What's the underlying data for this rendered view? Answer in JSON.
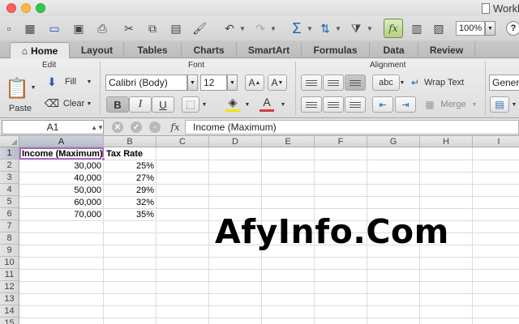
{
  "window": {
    "title": "Workbook"
  },
  "toolbar": {
    "zoom": "100%",
    "help": "?",
    "fx": "fx"
  },
  "ribbon_tabs": [
    "Home",
    "Layout",
    "Tables",
    "Charts",
    "SmartArt",
    "Formulas",
    "Data",
    "Review"
  ],
  "ribbon": {
    "groups": {
      "edit": "Edit",
      "font": "Font",
      "alignment": "Alignment"
    },
    "paste_label": "Paste",
    "fill_label": "Fill",
    "clear_label": "Clear",
    "font_name": "Calibri (Body)",
    "font_size": "12",
    "bold": "B",
    "italic": "I",
    "underline": "U",
    "abc": "abc",
    "wrap_text": "Wrap Text",
    "merge": "Merge",
    "number_format": "General",
    "font_color": "#d43c3c",
    "fill_color": "#f4e400"
  },
  "formula_bar": {
    "name_box": "A1",
    "fx": "fx",
    "content": "Income (Maximum)"
  },
  "columns": [
    "A",
    "B",
    "C",
    "D",
    "E",
    "F",
    "G",
    "H",
    "I"
  ],
  "rows": [
    "1",
    "2",
    "3",
    "4",
    "5",
    "6",
    "7",
    "8",
    "9",
    "10",
    "11",
    "12",
    "13",
    "14",
    "15"
  ],
  "sheet": {
    "headers": [
      "Income (Maximum)",
      "Tax Rate"
    ],
    "data": [
      [
        "30,000",
        "25%"
      ],
      [
        "40,000",
        "27%"
      ],
      [
        "50,000",
        "29%"
      ],
      [
        "60,000",
        "32%"
      ],
      [
        "70,000",
        "35%"
      ]
    ]
  },
  "watermark": "AfyInfo.Com",
  "colors": {
    "selection": "#a76bc8",
    "fx_active": "#b4cf83"
  }
}
